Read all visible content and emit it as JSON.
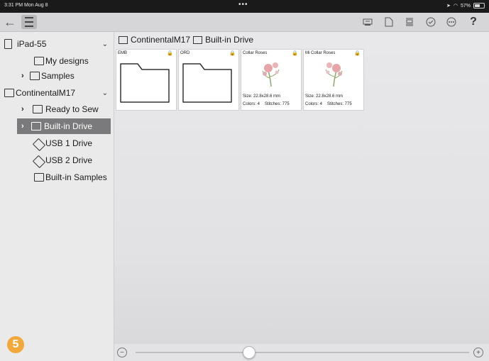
{
  "status": {
    "time": "3:31 PM  Mon Aug 8",
    "dots": "•••",
    "battery": "57%"
  },
  "toolbar": {
    "back": "←",
    "help": "?"
  },
  "sidebar": {
    "items": [
      {
        "label": "iPad-55"
      },
      {
        "label": "My designs"
      },
      {
        "label": "Samples"
      },
      {
        "label": "ContinentalM17"
      },
      {
        "label": "Ready to Sew"
      },
      {
        "label": "Built-in Drive"
      },
      {
        "label": "USB 1 Drive"
      },
      {
        "label": "USB 2 Drive"
      },
      {
        "label": "Built-in Samples"
      }
    ]
  },
  "breadcrumb": {
    "machine": "ContinentalM17",
    "location": "Built-in Drive"
  },
  "tiles": [
    {
      "name": "EMB",
      "lock": "🔒"
    },
    {
      "name": "ORD",
      "lock": "🔒"
    },
    {
      "name": "Collar Roses",
      "lock": "🔒",
      "size": "Size: 22.8x28.6 mm",
      "colors": "Colors: 4",
      "stitches": "Stitches: 775"
    },
    {
      "name": "Mi Collar Roses",
      "lock": "🔒",
      "size": "Size: 22.8x28.6 mm",
      "colors": "Colors: 4",
      "stitches": "Stitches: 775"
    }
  ],
  "step_badge": "5",
  "zoom": {
    "minus": "−",
    "plus": "+",
    "level": 0.34
  }
}
